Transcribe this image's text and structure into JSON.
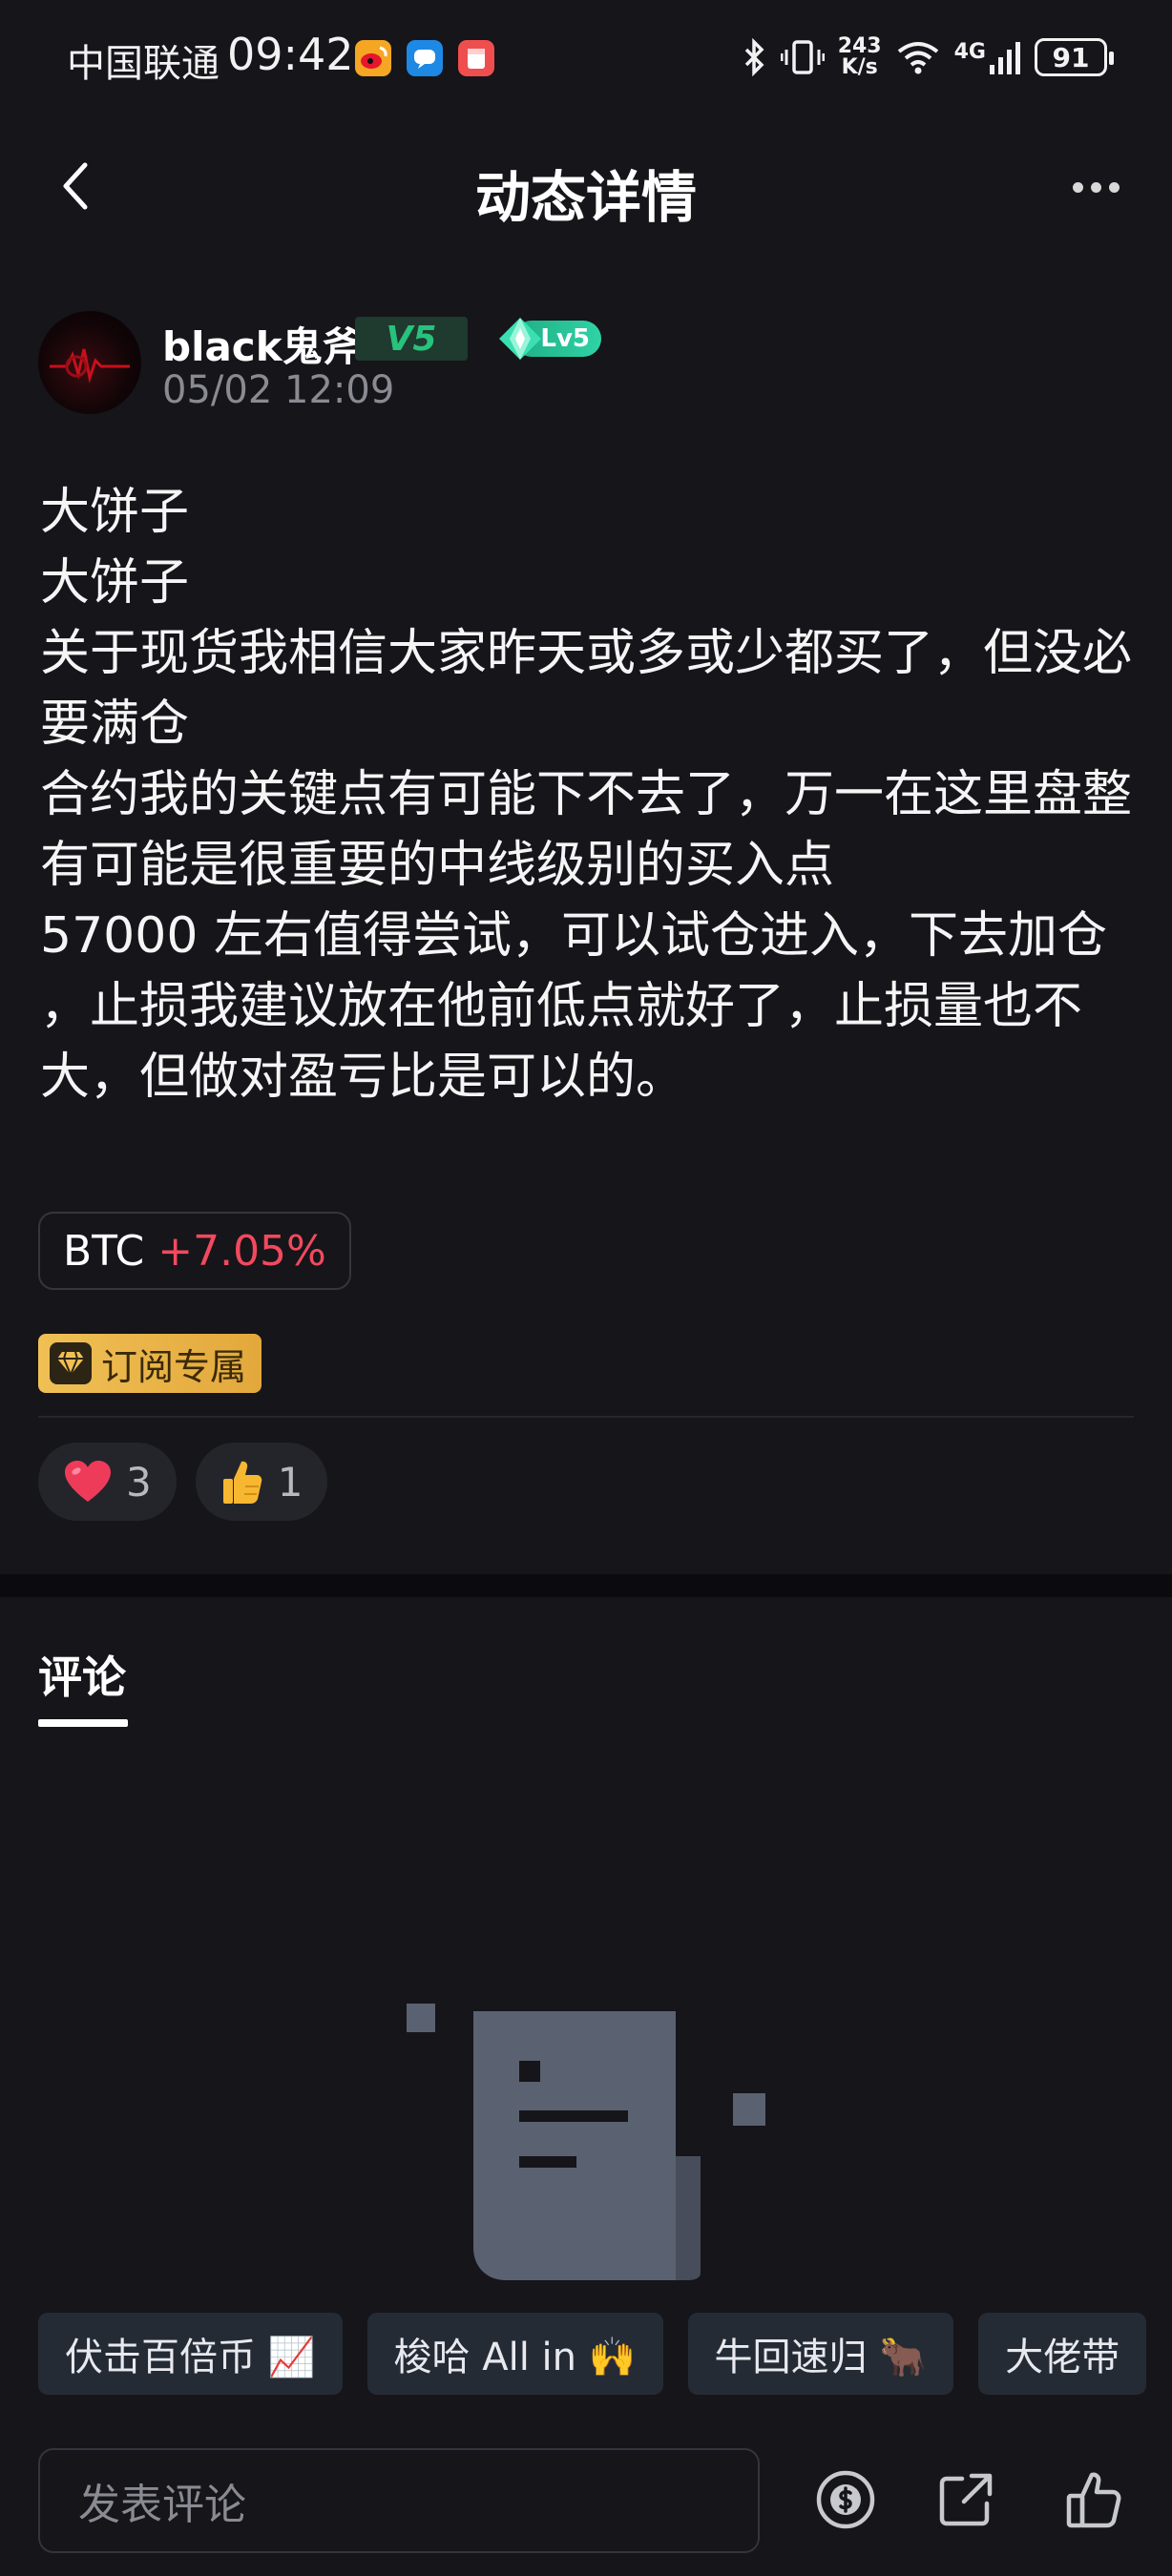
{
  "status_bar": {
    "carrier": "中国联通",
    "time": "09:42",
    "net_speed_value": "243",
    "net_speed_unit": "K/s",
    "network": "4G",
    "battery": "91"
  },
  "header": {
    "title": "动态详情"
  },
  "author": {
    "name": "black鬼斧",
    "vip_level": "V5",
    "user_level": "Lv5",
    "time": "05/02 12:09"
  },
  "post": {
    "lines": [
      "大饼子",
      "大饼子",
      "关于现货我相信大家昨天或多或少都买了，但没必要满仓",
      "合约我的关键点有可能下不去了，万一在这里盘整有可能是很重要的中线级别的买入点",
      "57000 左右值得尝试，可以试仓进入，下去加仓",
      "，止损我建议放在他前低点就好了，止损量也不大，但做对盈亏比是可以的。"
    ],
    "coin": {
      "symbol": "BTC",
      "change": "+7.05%"
    },
    "subscription_label": "订阅专属"
  },
  "reactions": [
    {
      "icon": "heart-icon",
      "emoji": "❤️",
      "count": "3"
    },
    {
      "icon": "thumbs-up-icon",
      "emoji": "👍",
      "count": "1"
    }
  ],
  "comments": {
    "tab_label": "评论"
  },
  "quick_replies": [
    "伏击百倍币 📈",
    "梭哈 All in 🙌",
    "牛回速归 🐂",
    "大佬带"
  ],
  "bottom_bar": {
    "comment_placeholder": "发表评论"
  },
  "colors": {
    "background": "#15151a",
    "positive_change": "#f2495e",
    "vip_green": "#27c27c",
    "subscription_gold": "#f0c055"
  }
}
